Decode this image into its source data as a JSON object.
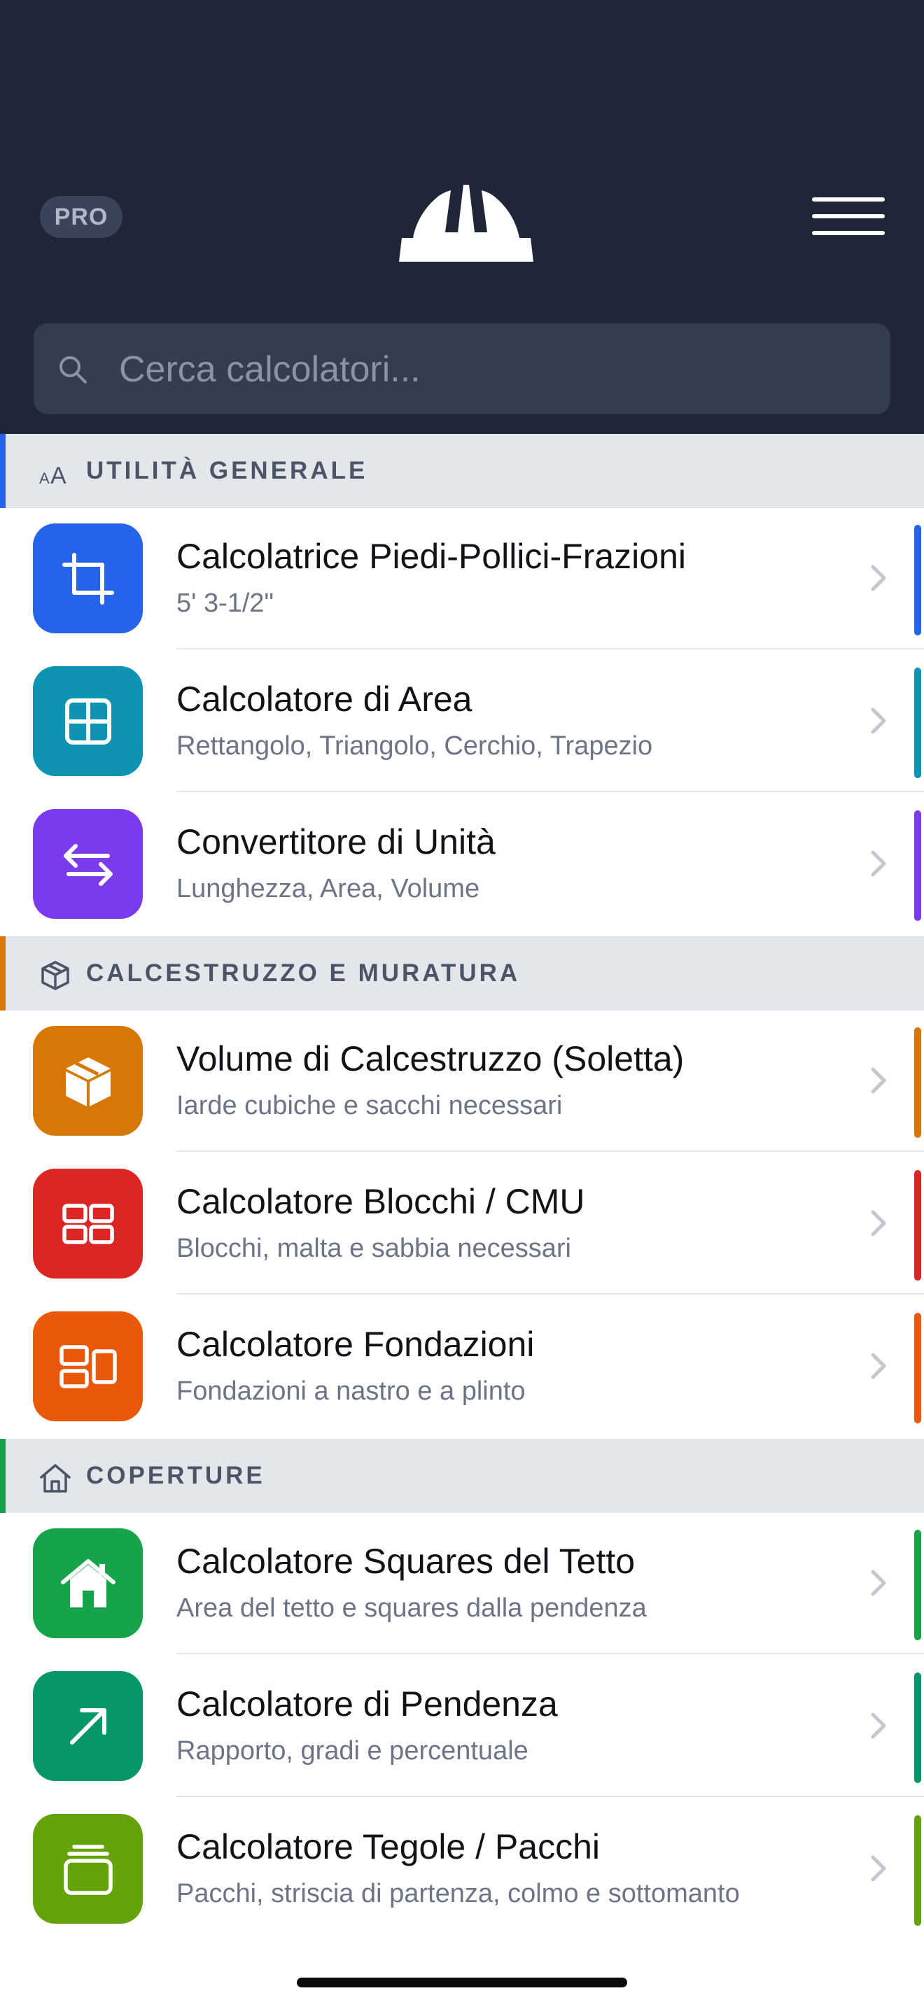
{
  "header": {
    "pro_badge": "PRO",
    "logo_icon": "hard-hat-icon",
    "menu_icon": "hamburger-menu-icon"
  },
  "search": {
    "placeholder": "Cerca calcolatori...",
    "value": ""
  },
  "sections": [
    {
      "title": "UTILITÀ GENERALE",
      "icon": "text-size-icon",
      "accent": "#2563eb",
      "items": [
        {
          "title": "Calcolatrice Piedi-Pollici-Frazioni",
          "subtitle": "5' 3-1/2\"",
          "icon": "crop-icon",
          "color": "#2563eb"
        },
        {
          "title": "Calcolatore di Area",
          "subtitle": "Rettangolo, Triangolo, Cerchio, Trapezio",
          "icon": "grid-icon",
          "color": "#0e93b3"
        },
        {
          "title": "Convertitore di Unità",
          "subtitle": "Lunghezza, Area, Volume",
          "icon": "swap-arrows-icon",
          "color": "#7c3aed"
        }
      ]
    },
    {
      "title": "CALCESTRUZZO E MURATURA",
      "icon": "cube-icon",
      "accent": "#d97706",
      "items": [
        {
          "title": "Volume di Calcestruzzo (Soletta)",
          "subtitle": "Iarde cubiche e sacchi necessari",
          "icon": "box-icon",
          "color": "#d97706"
        },
        {
          "title": "Calcolatore Blocchi / CMU",
          "subtitle": "Blocchi, malta e sabbia necessari",
          "icon": "blocks-icon",
          "color": "#dc2626"
        },
        {
          "title": "Calcolatore Fondazioni",
          "subtitle": "Fondazioni a nastro e a plinto",
          "icon": "foundation-icon",
          "color": "#ea580c"
        }
      ]
    },
    {
      "title": "COPERTURE",
      "icon": "house-icon",
      "accent": "#16a34a",
      "items": [
        {
          "title": "Calcolatore Squares del Tetto",
          "subtitle": "Area del tetto e squares dalla pendenza",
          "icon": "house-icon",
          "color": "#16a34a"
        },
        {
          "title": "Calcolatore di Pendenza",
          "subtitle": "Rapporto, gradi e percentuale",
          "icon": "arrow-up-right-icon",
          "color": "#059669"
        },
        {
          "title": "Calcolatore Tegole / Pacchi",
          "subtitle": "Pacchi, striscia di partenza, colmo e sottomanto",
          "icon": "stack-icon",
          "color": "#65a30d"
        }
      ]
    }
  ]
}
